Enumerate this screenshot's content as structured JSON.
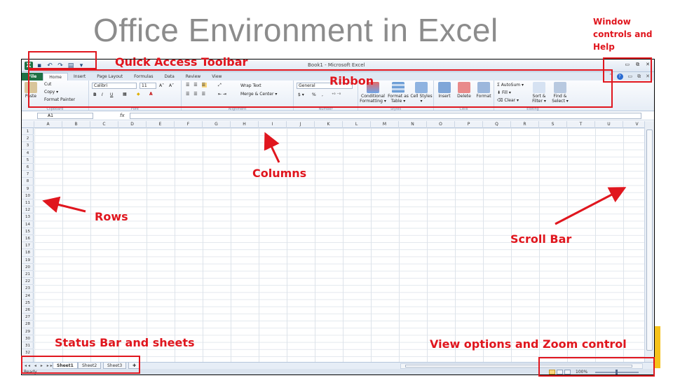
{
  "slide": {
    "title": "Office Environment in Excel"
  },
  "window": {
    "title": "Book1 - Microsoft Excel",
    "controls": [
      "▭",
      "⧉",
      "✕"
    ]
  },
  "qat": {
    "icons": [
      "excel-logo",
      "save-icon",
      "undo-icon",
      "redo-icon",
      "print-preview-icon",
      "dropdown-icon"
    ]
  },
  "tabs": [
    "File",
    "Home",
    "Insert",
    "Page Layout",
    "Formulas",
    "Data",
    "Review",
    "View"
  ],
  "ribbon": {
    "clipboard": {
      "paste": "Paste",
      "cut": "Cut",
      "copy": "Copy ▾",
      "format_painter": "Format Painter",
      "label": "Clipboard"
    },
    "font": {
      "name": "Calibri",
      "size": "11",
      "grow": "A˄",
      "shrink": "A˅",
      "bold": "B",
      "italic": "I",
      "underline": "U",
      "label": "Font"
    },
    "alignment": {
      "wrap_text": "Wrap Text",
      "merge_center": "Merge & Center ▾",
      "label": "Alignment"
    },
    "number": {
      "format": "General",
      "currency": "$ ▾",
      "percent": "%",
      "comma": ",",
      "label": "Number"
    },
    "styles": {
      "conditional": "Conditional Formatting ▾",
      "format_table": "Format as Table ▾",
      "cell_styles": "Cell Styles ▾",
      "label": "Styles"
    },
    "cells": {
      "insert": "Insert",
      "delete": "Delete",
      "format": "Format",
      "label": "Cells"
    },
    "editing": {
      "autosum": "AutoSum ▾",
      "fill": "Fill ▾",
      "clear": "Clear ▾",
      "sort": "Sort & Filter ▾",
      "find": "Find & Select ▾",
      "label": "Editing"
    }
  },
  "formula_bar": {
    "name_box": "A1",
    "fx": "fx"
  },
  "columns": [
    "A",
    "B",
    "C",
    "D",
    "E",
    "F",
    "G",
    "H",
    "I",
    "J",
    "K",
    "L",
    "M",
    "N",
    "O",
    "P",
    "Q",
    "R",
    "S",
    "T",
    "U",
    "V"
  ],
  "rows": [
    "1",
    "2",
    "3",
    "4",
    "5",
    "6",
    "7",
    "8",
    "9",
    "10",
    "11",
    "12",
    "13",
    "14",
    "15",
    "16",
    "17",
    "18",
    "19",
    "20",
    "21",
    "22",
    "23",
    "24",
    "25",
    "26",
    "27",
    "28",
    "29",
    "30",
    "31",
    "32"
  ],
  "sheets": [
    "Sheet1",
    "Sheet2",
    "Sheet3"
  ],
  "status": {
    "ready": "Ready",
    "zoom": "100%"
  },
  "annotations": {
    "window_controls": "Window controls and Help",
    "qat": "Quick Access Toolbar",
    "ribbon": "Ribbon",
    "columns": "Columns",
    "rows": "Rows",
    "scroll_bar": "Scroll Bar",
    "status_bar": "Status Bar and sheets",
    "view_zoom": "View options and Zoom control"
  },
  "colors": {
    "annotation_red": "#e0161e",
    "excel_green": "#1e7145",
    "title_gray": "#8c8c8c"
  }
}
